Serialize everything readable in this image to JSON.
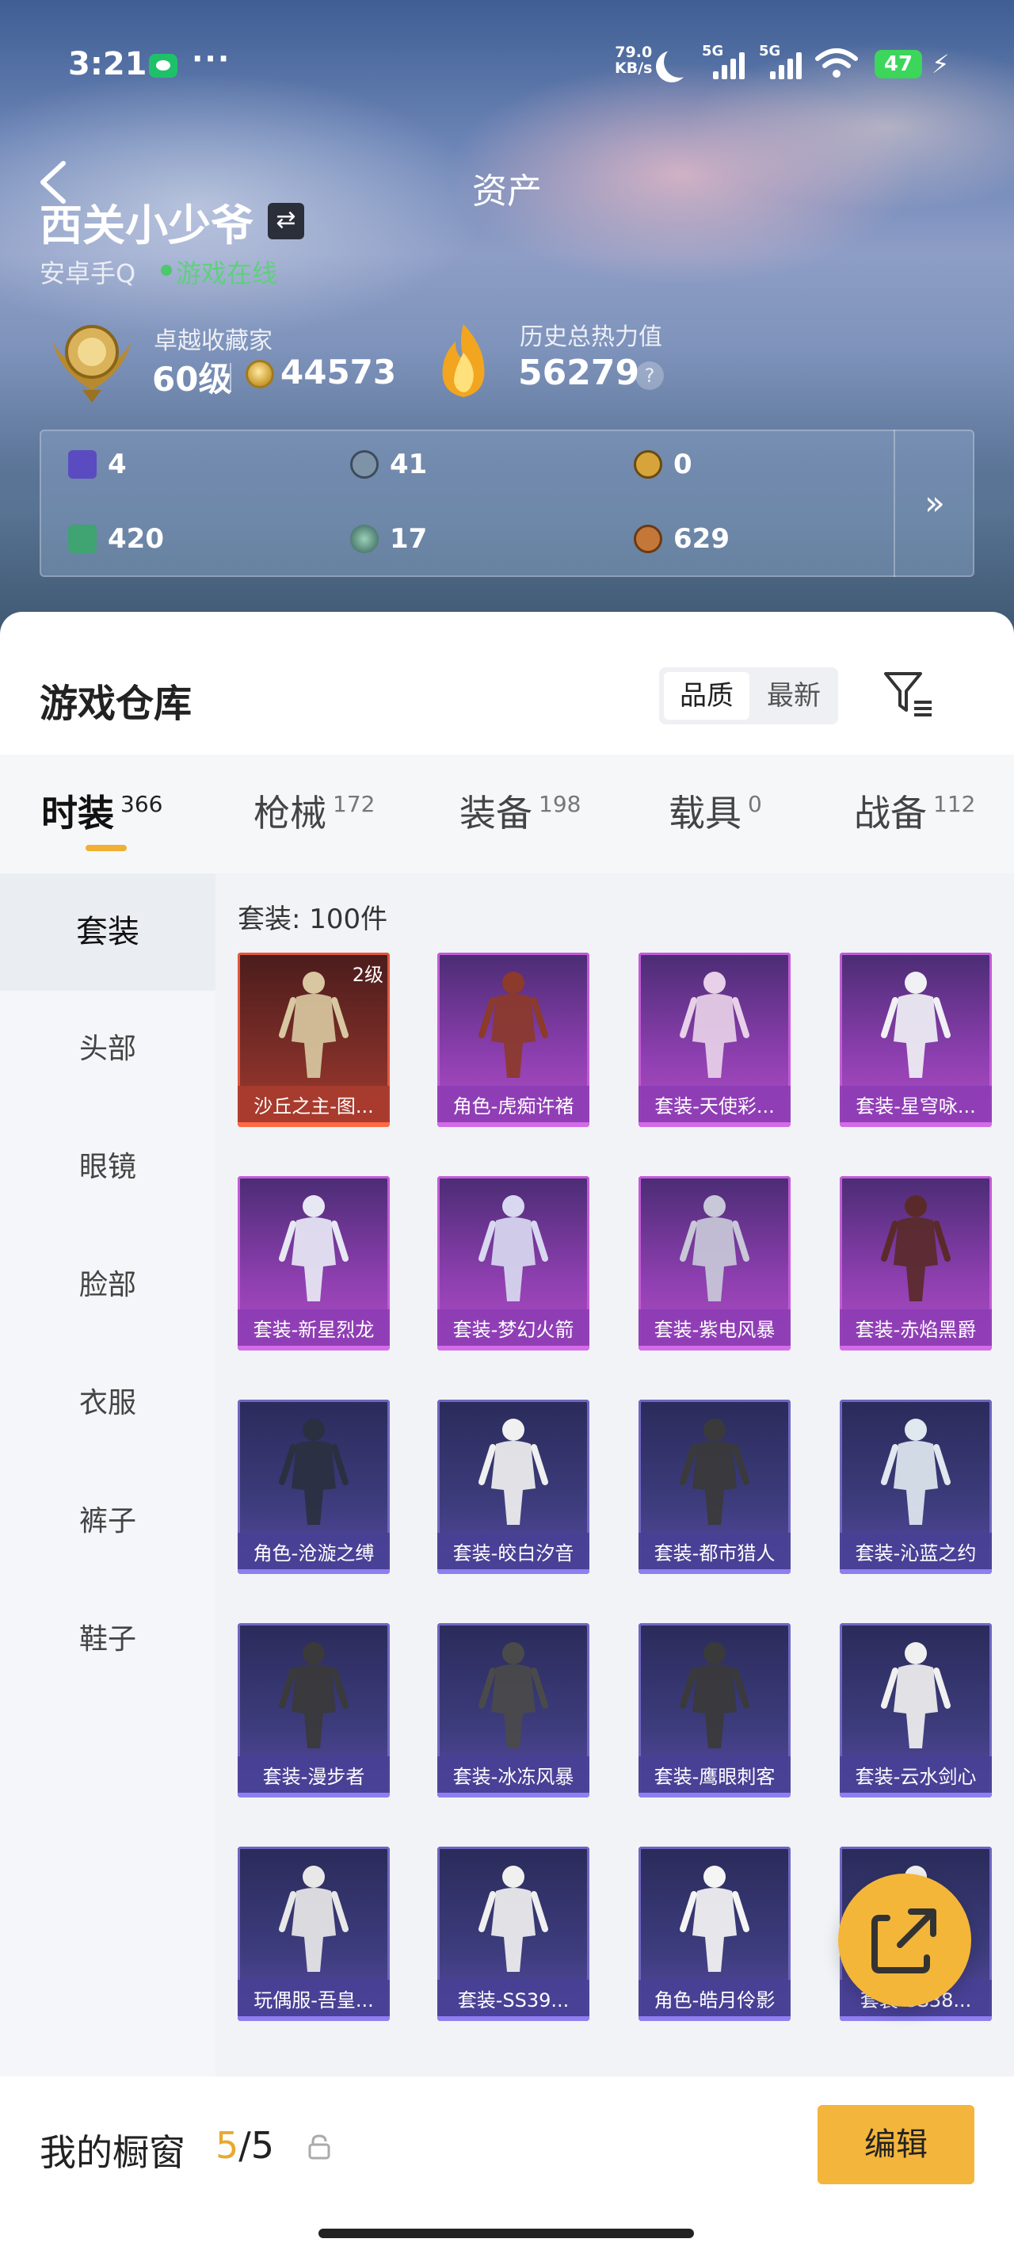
{
  "status_bar": {
    "time": "3:21",
    "net_speed_value": "79.0",
    "net_speed_unit": "KB/s",
    "signal_1": "5G",
    "signal_2": "5G",
    "battery": "47"
  },
  "header": {
    "title": "资产",
    "username": "西关小少爷",
    "platform": "安卓手Q",
    "online_status": "游戏在线"
  },
  "stats": {
    "collector_title": "卓越收藏家",
    "collector_level": "60级",
    "coins": "44573",
    "heat_title": "历史总热力值",
    "heat_value": "56279",
    "help": "?"
  },
  "resources": {
    "items": [
      {
        "value": "4",
        "icon": "purple-card-icon",
        "color": "#6f5bd6"
      },
      {
        "value": "41",
        "icon": "silver-coin-icon",
        "color": "#8fa3b8"
      },
      {
        "value": "0",
        "icon": "gold-token-icon",
        "color": "#d6a43a"
      },
      {
        "value": "420",
        "icon": "green-card-icon",
        "color": "#3fa372"
      },
      {
        "value": "17",
        "icon": "teal-orb-icon",
        "color": "#4f8f84"
      },
      {
        "value": "629",
        "icon": "bronze-coin-icon",
        "color": "#c3783a"
      }
    ],
    "more": "»"
  },
  "warehouse": {
    "title": "游戏仓库",
    "sort_options": [
      "品质",
      "最新"
    ],
    "tabs": [
      {
        "label": "时装",
        "count": "366"
      },
      {
        "label": "枪械",
        "count": "172"
      },
      {
        "label": "装备",
        "count": "198"
      },
      {
        "label": "载具",
        "count": "0"
      },
      {
        "label": "战备",
        "count": "112"
      }
    ],
    "categories": [
      "套装",
      "头部",
      "眼镜",
      "脸部",
      "衣服",
      "裤子",
      "鞋子"
    ],
    "set_count": "套装: 100件",
    "items": [
      {
        "name": "沙丘之主-图...",
        "rarity": "red",
        "level": "2级"
      },
      {
        "name": "角色-虎痴许褚",
        "rarity": "purple"
      },
      {
        "name": "套装-天使彩...",
        "rarity": "purple"
      },
      {
        "name": "套装-星穹咏...",
        "rarity": "purple"
      },
      {
        "name": "套装-新星烈龙",
        "rarity": "purple"
      },
      {
        "name": "套装-梦幻火箭",
        "rarity": "purple"
      },
      {
        "name": "套装-紫电风暴",
        "rarity": "purple"
      },
      {
        "name": "套装-赤焰黑爵",
        "rarity": "purple"
      },
      {
        "name": "角色-沧漩之缚",
        "rarity": "blue"
      },
      {
        "name": "套装-皎白汐音",
        "rarity": "blue"
      },
      {
        "name": "套装-都市猎人",
        "rarity": "blue"
      },
      {
        "name": "套装-沁蓝之约",
        "rarity": "blue"
      },
      {
        "name": "套装-漫步者",
        "rarity": "blue"
      },
      {
        "name": "套装-冰冻风暴",
        "rarity": "blue"
      },
      {
        "name": "套装-鹰眼刺客",
        "rarity": "blue"
      },
      {
        "name": "套装-云水剑心",
        "rarity": "blue"
      },
      {
        "name": "玩偶服-吾皇...",
        "rarity": "blue"
      },
      {
        "name": "套装-SS39...",
        "rarity": "blue"
      },
      {
        "name": "角色-皓月伶影",
        "rarity": "blue"
      },
      {
        "name": "套装-SS38...",
        "rarity": "blue"
      }
    ]
  },
  "showcase": {
    "label": "我的橱窗",
    "current": "5",
    "total": "/5",
    "edit_label": "编辑"
  }
}
